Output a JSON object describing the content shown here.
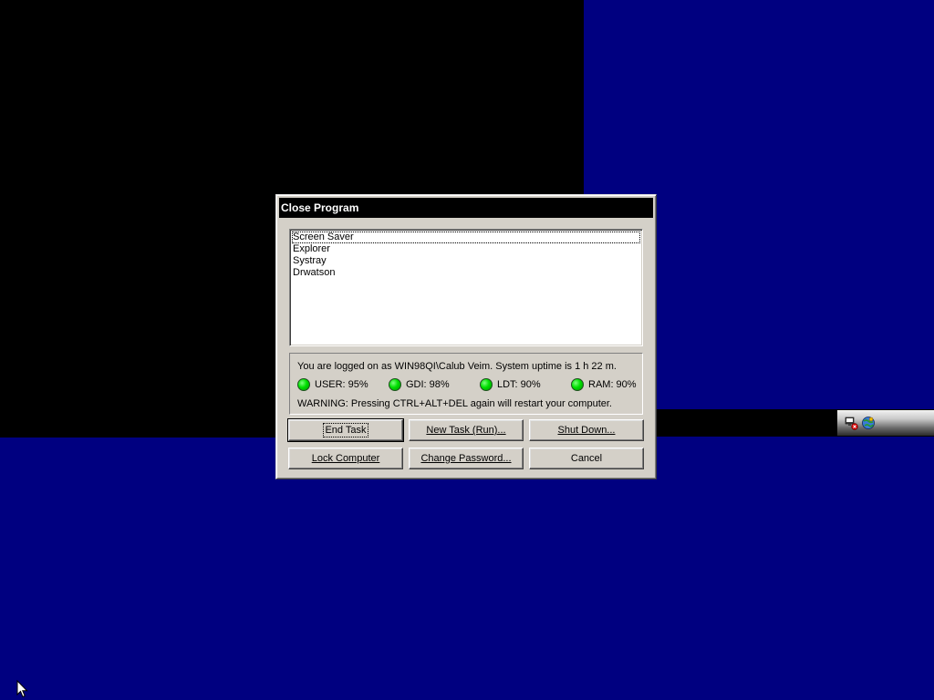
{
  "dialog": {
    "title": "Close Program",
    "processes": [
      "Screen Saver",
      "Explorer",
      "Systray",
      "Drwatson"
    ],
    "selected_index": 0,
    "logon_text": "You are logged on as WIN98QI\\Calub Veim. System uptime is 1 h 22 m.",
    "meters": [
      {
        "label": "USER: 95%",
        "status_color": "#00e000"
      },
      {
        "label": "GDI: 98%",
        "status_color": "#00e000"
      },
      {
        "label": "LDT: 90%",
        "status_color": "#00e000"
      },
      {
        "label": "RAM: 90%",
        "status_color": "#00e000"
      }
    ],
    "warning_text": "WARNING: Pressing CTRL+ALT+DEL again will restart your computer.",
    "buttons": {
      "end_task": "End Task",
      "new_task": "New Task (Run)...",
      "shut_down": "Shut Down...",
      "lock_computer": "Lock Computer",
      "change_password": "Change Password...",
      "cancel": "Cancel"
    }
  },
  "tray": {
    "icons": [
      "network-icon",
      "globe-icon"
    ]
  },
  "colors": {
    "desktop": "#000080",
    "titlebar": "#000000",
    "dialog_face": "#d4d0c8"
  }
}
